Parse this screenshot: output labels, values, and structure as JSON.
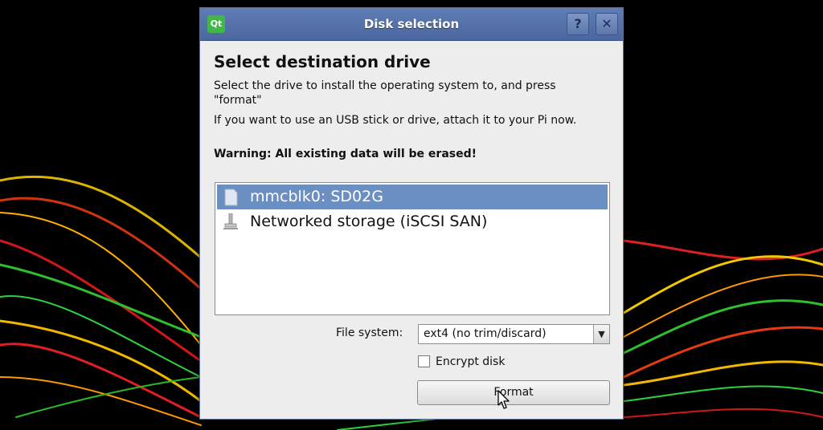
{
  "dialog": {
    "title": "Disk selection",
    "logo_text": "Qt",
    "help_label": "?",
    "close_label": "✕",
    "heading": "Select destination drive",
    "paragraphs": [
      "Select the drive to install the operating system to, and press \"format\"",
      "If you want to use an USB stick or drive, attach it to your Pi now.",
      "Warning: All existing data will be erased!"
    ],
    "drives": [
      {
        "label": "mmcblk0: SD02G",
        "icon": "sd-card-icon",
        "selected": true
      },
      {
        "label": "Networked storage (iSCSI SAN)",
        "icon": "network-storage-icon",
        "selected": false
      }
    ],
    "file_system_label": "File system:",
    "file_system_value": "ext4 (no trim/discard)",
    "dropdown_arrow": "▼",
    "encrypt_label": "Encrypt disk",
    "encrypt_checked": false,
    "format_label": "Format"
  },
  "colors": {
    "titlebar": "#5470a8",
    "selection": "#6b8fc1",
    "dialog_bg": "#ededed"
  }
}
